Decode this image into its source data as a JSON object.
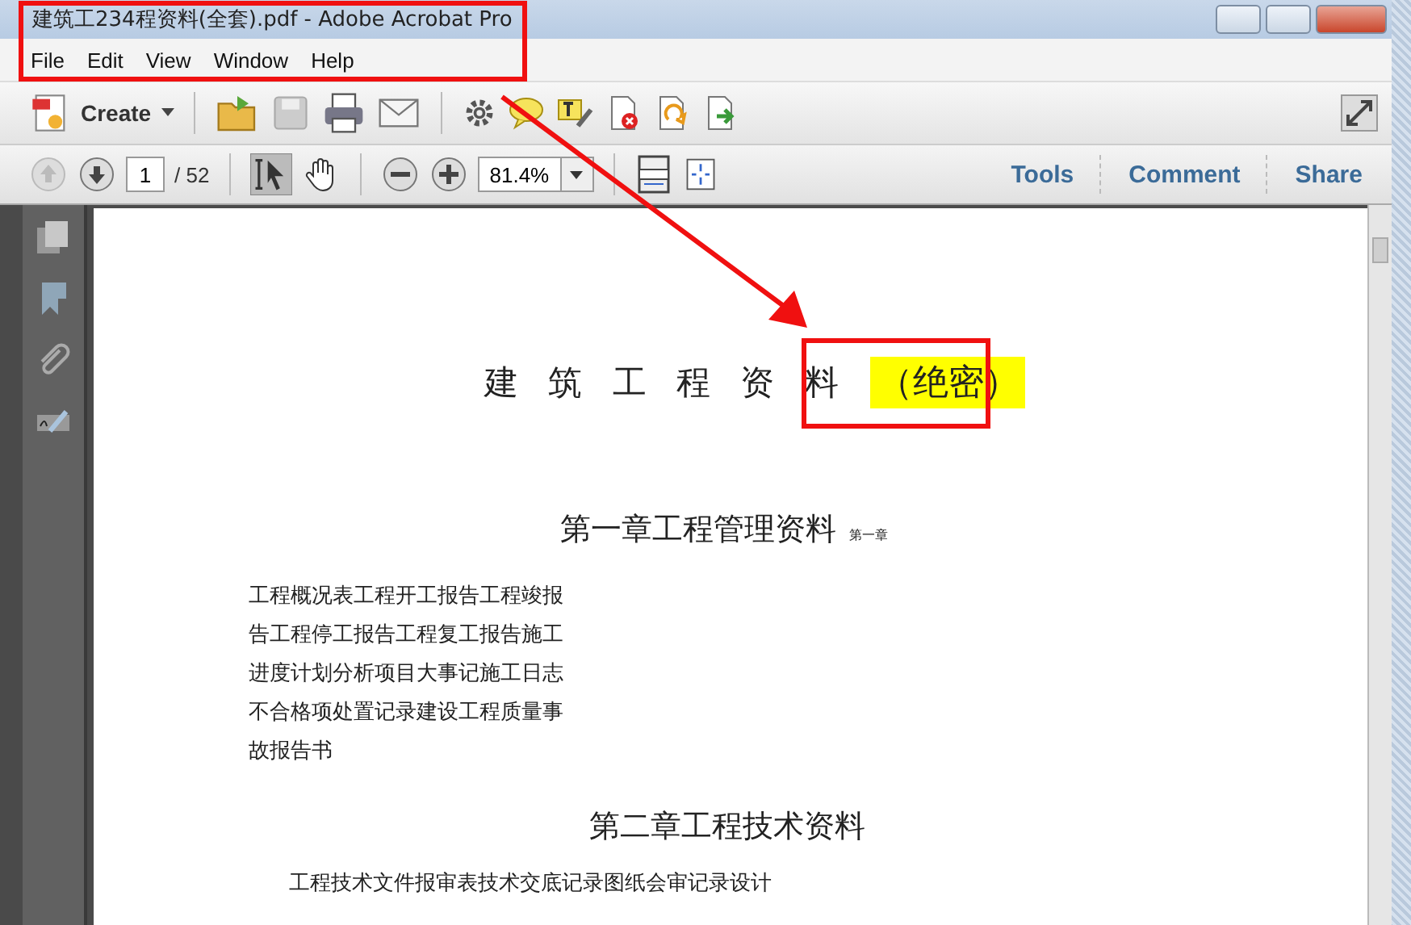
{
  "window": {
    "title": "建筑工234程资料(全套).pdf - Adobe Acrobat Pro"
  },
  "menu": [
    "File",
    "Edit",
    "View",
    "Window",
    "Help"
  ],
  "toolbar": {
    "create": "Create"
  },
  "navigation": {
    "page": "1",
    "total": "/ 52",
    "zoom": "81.4%"
  },
  "panes": [
    "Tools",
    "Comment",
    "Share"
  ],
  "document": {
    "title": "建 筑 工 程 资 料",
    "title_mark": "（绝密）",
    "sections": [
      {
        "heading": "第一章工程管理资料",
        "heading_note": "第一章",
        "lines": [
          "工程概况表工程开工报告工程竣报",
          "告工程停工报告工程复工报告施工",
          "进度计划分析项目大事记施工日志",
          "不合格项处置记录建设工程质量事",
          "故报告书"
        ]
      },
      {
        "heading": "第二章工程技术资料",
        "lines": [
          "工程技术文件报审表技术交底记录图纸会审记录设计"
        ]
      }
    ]
  }
}
